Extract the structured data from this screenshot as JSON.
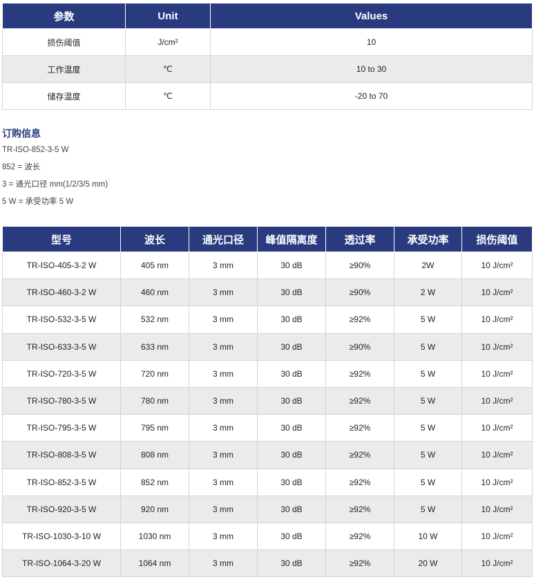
{
  "params_table": {
    "headers": [
      "参数",
      "Unit",
      "Values"
    ],
    "rows": [
      {
        "param": "损伤阈值",
        "unit": "J/cm²",
        "value": "10"
      },
      {
        "param": "工作温度",
        "unit": "℃",
        "value": "10 to 30"
      },
      {
        "param": "储存温度",
        "unit": "℃",
        "value": "-20 to 70"
      }
    ]
  },
  "order_info": {
    "title": "订购信息",
    "lines": [
      "TR-ISO-852-3-5 W",
      "852 = 波长",
      "3 = 通光口径 mm(1/2/3/5 mm)",
      "5 W = 承受功率 5 W"
    ]
  },
  "models_table": {
    "headers": [
      "型号",
      "波长",
      "通光口径",
      "峰值隔离度",
      "透过率",
      "承受功率",
      "损伤阈值"
    ],
    "rows": [
      [
        "TR-ISO-405-3-2 W",
        "405 nm",
        "3 mm",
        "30 dB",
        "≥90%",
        "2W",
        "10 J/cm²"
      ],
      [
        "TR-ISO-460-3-2 W",
        "460 nm",
        "3 mm",
        "30 dB",
        "≥90%",
        "2 W",
        "10 J/cm²"
      ],
      [
        "TR-ISO-532-3-5 W",
        "532 nm",
        "3 mm",
        "30 dB",
        "≥92%",
        "5 W",
        "10 J/cm²"
      ],
      [
        "TR-ISO-633-3-5 W",
        "633 nm",
        "3 mm",
        "30 dB",
        "≥90%",
        "5 W",
        "10 J/cm²"
      ],
      [
        "TR-ISO-720-3-5 W",
        "720 nm",
        "3 mm",
        "30 dB",
        "≥92%",
        "5 W",
        "10 J/cm²"
      ],
      [
        "TR-ISO-780-3-5 W",
        "780 nm",
        "3 mm",
        "30 dB",
        "≥92%",
        "5 W",
        "10 J/cm²"
      ],
      [
        "TR-ISO-795-3-5 W",
        "795 nm",
        "3 mm",
        "30 dB",
        "≥92%",
        "5 W",
        "10 J/cm²"
      ],
      [
        "TR-ISO-808-3-5 W",
        "808 nm",
        "3 mm",
        "30 dB",
        "≥92%",
        "5 W",
        "10 J/cm²"
      ],
      [
        "TR-ISO-852-3-5 W",
        "852 nm",
        "3 mm",
        "30 dB",
        "≥92%",
        "5 W",
        "10 J/cm²"
      ],
      [
        "TR-ISO-920-3-5 W",
        "920 nm",
        "3 mm",
        "30 dB",
        "≥92%",
        "5 W",
        "10 J/cm²"
      ],
      [
        "TR-ISO-1030-3-10 W",
        "1030 nm",
        "3 mm",
        "30 dB",
        "≥92%",
        "10 W",
        "10 J/cm²"
      ],
      [
        "TR-ISO-1064-3-20 W",
        "1064 nm",
        "3 mm",
        "30 dB",
        "≥92%",
        "20 W",
        "10 J/cm²"
      ]
    ]
  },
  "colors": {
    "header_bg": "#293a7f",
    "header_text": "#ffffff",
    "alt_row_bg": "#ebebeb",
    "title_color": "#293a7f"
  }
}
